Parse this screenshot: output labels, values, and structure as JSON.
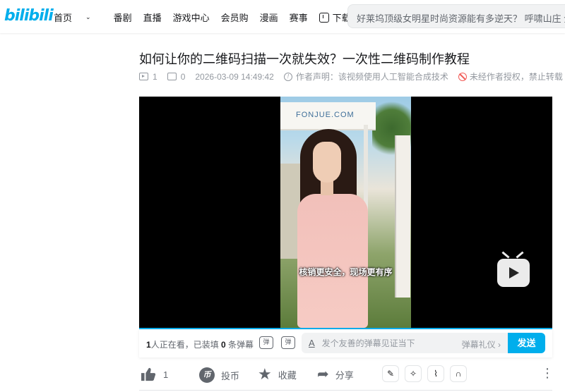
{
  "header": {
    "logo": "bilibili",
    "nav": [
      "首页",
      "番剧",
      "直播",
      "游戏中心",
      "会员购",
      "漫画",
      "赛事",
      "下载客户端"
    ],
    "search_placeholder": "好莱坞顶级女明星时尚资源能有多逆天？ 呼啸山庄 全球首"
  },
  "video": {
    "title": "如何让你的二维码扫描一次就失效？一次性二维码制作教程",
    "play_count": "1",
    "danmaku_count": "0",
    "pubdate": "2026-03-09 14:49:42",
    "declaration": "作者声明：该视频使用人工智能合成技术",
    "copyright": "未经作者授权，禁止转载",
    "caption": "核销更安全，现场更有序",
    "scene_banner": "FONJUE.COM"
  },
  "danmaku_bar": {
    "watching_pre": "1",
    "watching_mid": "人正在看，已装填 ",
    "watching_count": "0",
    "watching_post": " 条弹幕",
    "icon1": "弹",
    "icon2": "弹",
    "input_placeholder": "发个友善的弹幕见证当下",
    "etiquette": "弹幕礼仪 ›",
    "send": "发送"
  },
  "toolbar": {
    "like_count": "1",
    "coin_label": "投币",
    "fav_label": "收藏",
    "share_label": "分享"
  },
  "colors": {
    "accent": "#00aeec",
    "text": "#18191c",
    "muted": "#9499a0",
    "warn": "#f25d59"
  }
}
